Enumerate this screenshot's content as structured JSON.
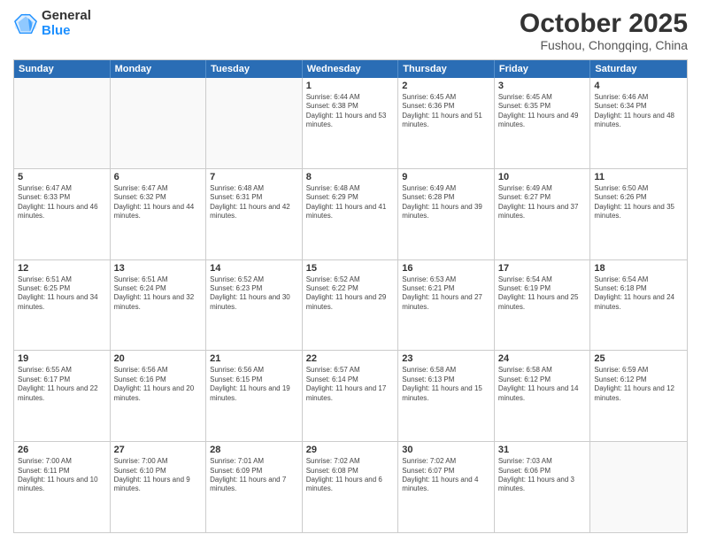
{
  "logo": {
    "general": "General",
    "blue": "Blue"
  },
  "title": "October 2025",
  "subtitle": "Fushou, Chongqing, China",
  "days_of_week": [
    "Sunday",
    "Monday",
    "Tuesday",
    "Wednesday",
    "Thursday",
    "Friday",
    "Saturday"
  ],
  "weeks": [
    [
      {
        "day": "",
        "text": ""
      },
      {
        "day": "",
        "text": ""
      },
      {
        "day": "",
        "text": ""
      },
      {
        "day": "1",
        "text": "Sunrise: 6:44 AM\nSunset: 6:38 PM\nDaylight: 11 hours and 53 minutes."
      },
      {
        "day": "2",
        "text": "Sunrise: 6:45 AM\nSunset: 6:36 PM\nDaylight: 11 hours and 51 minutes."
      },
      {
        "day": "3",
        "text": "Sunrise: 6:45 AM\nSunset: 6:35 PM\nDaylight: 11 hours and 49 minutes."
      },
      {
        "day": "4",
        "text": "Sunrise: 6:46 AM\nSunset: 6:34 PM\nDaylight: 11 hours and 48 minutes."
      }
    ],
    [
      {
        "day": "5",
        "text": "Sunrise: 6:47 AM\nSunset: 6:33 PM\nDaylight: 11 hours and 46 minutes."
      },
      {
        "day": "6",
        "text": "Sunrise: 6:47 AM\nSunset: 6:32 PM\nDaylight: 11 hours and 44 minutes."
      },
      {
        "day": "7",
        "text": "Sunrise: 6:48 AM\nSunset: 6:31 PM\nDaylight: 11 hours and 42 minutes."
      },
      {
        "day": "8",
        "text": "Sunrise: 6:48 AM\nSunset: 6:29 PM\nDaylight: 11 hours and 41 minutes."
      },
      {
        "day": "9",
        "text": "Sunrise: 6:49 AM\nSunset: 6:28 PM\nDaylight: 11 hours and 39 minutes."
      },
      {
        "day": "10",
        "text": "Sunrise: 6:49 AM\nSunset: 6:27 PM\nDaylight: 11 hours and 37 minutes."
      },
      {
        "day": "11",
        "text": "Sunrise: 6:50 AM\nSunset: 6:26 PM\nDaylight: 11 hours and 35 minutes."
      }
    ],
    [
      {
        "day": "12",
        "text": "Sunrise: 6:51 AM\nSunset: 6:25 PM\nDaylight: 11 hours and 34 minutes."
      },
      {
        "day": "13",
        "text": "Sunrise: 6:51 AM\nSunset: 6:24 PM\nDaylight: 11 hours and 32 minutes."
      },
      {
        "day": "14",
        "text": "Sunrise: 6:52 AM\nSunset: 6:23 PM\nDaylight: 11 hours and 30 minutes."
      },
      {
        "day": "15",
        "text": "Sunrise: 6:52 AM\nSunset: 6:22 PM\nDaylight: 11 hours and 29 minutes."
      },
      {
        "day": "16",
        "text": "Sunrise: 6:53 AM\nSunset: 6:21 PM\nDaylight: 11 hours and 27 minutes."
      },
      {
        "day": "17",
        "text": "Sunrise: 6:54 AM\nSunset: 6:19 PM\nDaylight: 11 hours and 25 minutes."
      },
      {
        "day": "18",
        "text": "Sunrise: 6:54 AM\nSunset: 6:18 PM\nDaylight: 11 hours and 24 minutes."
      }
    ],
    [
      {
        "day": "19",
        "text": "Sunrise: 6:55 AM\nSunset: 6:17 PM\nDaylight: 11 hours and 22 minutes."
      },
      {
        "day": "20",
        "text": "Sunrise: 6:56 AM\nSunset: 6:16 PM\nDaylight: 11 hours and 20 minutes."
      },
      {
        "day": "21",
        "text": "Sunrise: 6:56 AM\nSunset: 6:15 PM\nDaylight: 11 hours and 19 minutes."
      },
      {
        "day": "22",
        "text": "Sunrise: 6:57 AM\nSunset: 6:14 PM\nDaylight: 11 hours and 17 minutes."
      },
      {
        "day": "23",
        "text": "Sunrise: 6:58 AM\nSunset: 6:13 PM\nDaylight: 11 hours and 15 minutes."
      },
      {
        "day": "24",
        "text": "Sunrise: 6:58 AM\nSunset: 6:12 PM\nDaylight: 11 hours and 14 minutes."
      },
      {
        "day": "25",
        "text": "Sunrise: 6:59 AM\nSunset: 6:12 PM\nDaylight: 11 hours and 12 minutes."
      }
    ],
    [
      {
        "day": "26",
        "text": "Sunrise: 7:00 AM\nSunset: 6:11 PM\nDaylight: 11 hours and 10 minutes."
      },
      {
        "day": "27",
        "text": "Sunrise: 7:00 AM\nSunset: 6:10 PM\nDaylight: 11 hours and 9 minutes."
      },
      {
        "day": "28",
        "text": "Sunrise: 7:01 AM\nSunset: 6:09 PM\nDaylight: 11 hours and 7 minutes."
      },
      {
        "day": "29",
        "text": "Sunrise: 7:02 AM\nSunset: 6:08 PM\nDaylight: 11 hours and 6 minutes."
      },
      {
        "day": "30",
        "text": "Sunrise: 7:02 AM\nSunset: 6:07 PM\nDaylight: 11 hours and 4 minutes."
      },
      {
        "day": "31",
        "text": "Sunrise: 7:03 AM\nSunset: 6:06 PM\nDaylight: 11 hours and 3 minutes."
      },
      {
        "day": "",
        "text": ""
      }
    ]
  ]
}
